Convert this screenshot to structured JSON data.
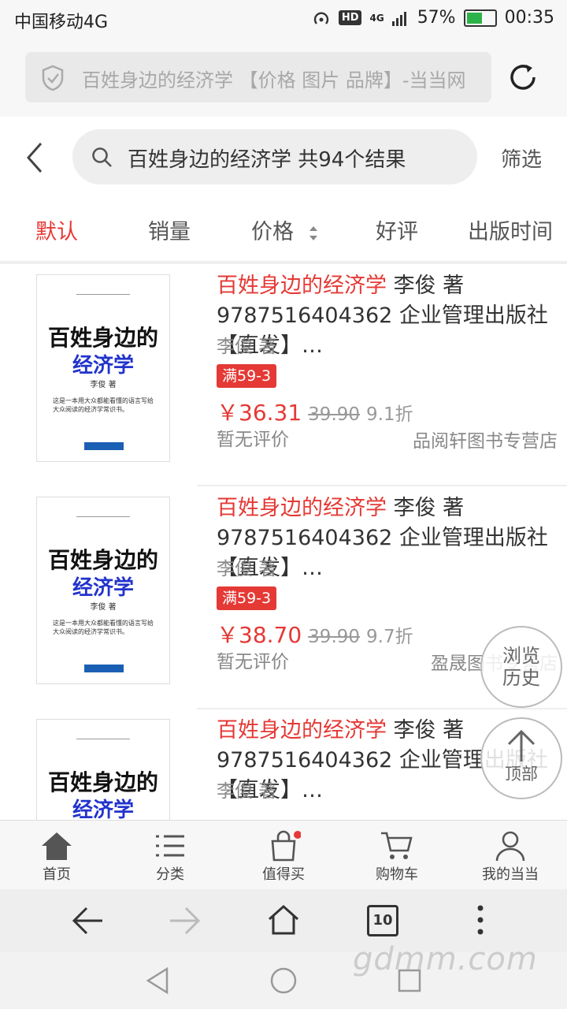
{
  "status_bar": {
    "carrier": "中国移动4G",
    "hd": "HD",
    "network": "4G",
    "battery": "57%",
    "time": "00:35"
  },
  "url_bar": {
    "text": "百姓身边的经济学 【价格 图片 品牌】-当当网"
  },
  "search": {
    "query": "百姓身边的经济学 共94个结果",
    "filter_label": "筛选"
  },
  "sort_tabs": [
    {
      "label": "默认",
      "active": true
    },
    {
      "label": "销量",
      "active": false
    },
    {
      "label": "价格",
      "active": false
    },
    {
      "label": "好评",
      "active": false
    },
    {
      "label": "出版时间",
      "active": false
    }
  ],
  "cover": {
    "line1": "百姓身边的",
    "line2": "经济学",
    "author": "李俊 著",
    "desc": "这是一本用大众都能看懂的语言写给大众阅读的经济学常识书。"
  },
  "products": [
    {
      "title_hl": "百姓身边的经济学",
      "title_rest": " 李俊 著 9787516404362 企业管理出版社【直发】…",
      "author": "李俊 著",
      "promo": "满59-3",
      "price": "￥36.31",
      "orig_price": "39.90",
      "discount": "9.1折",
      "review": "暂无评价",
      "shop": "品阅轩图书专营店"
    },
    {
      "title_hl": "百姓身边的经济学",
      "title_rest": " 李俊 著 9787516404362 企业管理出版社【直发】…",
      "author": "李俊 著",
      "promo": "满59-3",
      "price": "￥38.70",
      "orig_price": "39.90",
      "discount": "9.7折",
      "review": "暂无评价",
      "shop": "盈晟图书专营店"
    },
    {
      "title_hl": "百姓身边的经济学",
      "title_rest": " 李俊 著 9787516404362 企业管理出版社【直发】…",
      "author": "李俊 著"
    }
  ],
  "float": {
    "history": [
      "浏览",
      "历史"
    ],
    "top": "顶部"
  },
  "bottom_nav": [
    {
      "label": "首页",
      "icon": "home-icon"
    },
    {
      "label": "分类",
      "icon": "list-icon"
    },
    {
      "label": "值得买",
      "icon": "bag-icon"
    },
    {
      "label": "购物车",
      "icon": "cart-icon"
    },
    {
      "label": "我的当当",
      "icon": "user-icon"
    }
  ],
  "browser": {
    "tab_count": "10"
  },
  "watermark": "gdmm.com",
  "colors": {
    "accent": "#e53935",
    "cover_blue": "#2233cc"
  }
}
